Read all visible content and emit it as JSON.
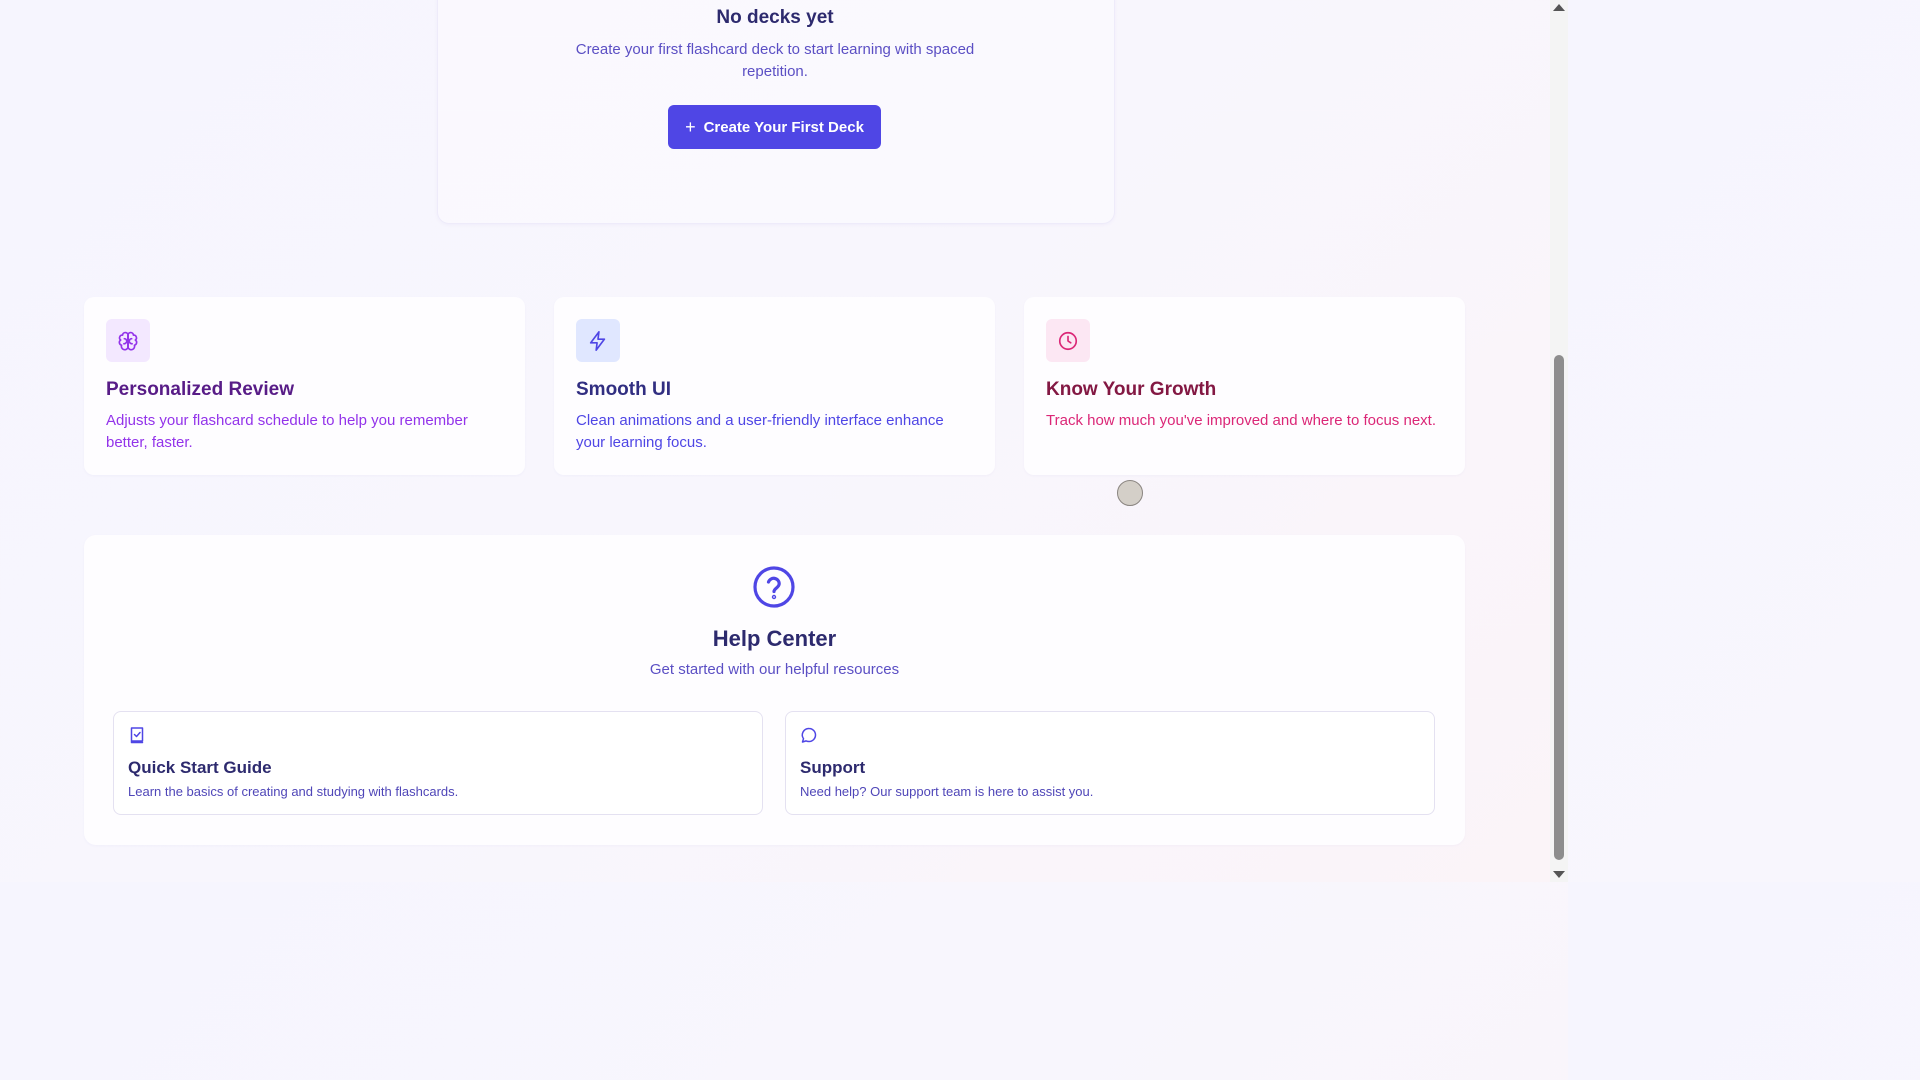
{
  "empty_state": {
    "title": "No decks yet",
    "description": "Create your first flashcard deck to start learning with spaced repetition.",
    "button_label": "Create Your First Deck",
    "button_icon": "plus-icon"
  },
  "features": [
    {
      "icon": "brain-icon",
      "title": "Personalized Review",
      "description": "Adjusts your flashcard schedule to help you remember better, faster.",
      "title_color": "#581c87",
      "desc_color": "#9333ea",
      "icon_bg": "#f3e8ff",
      "icon_color": "#9333ea"
    },
    {
      "icon": "lightning-icon",
      "title": "Smooth UI",
      "description": "Clean animations and a user-friendly interface enhance your learning focus.",
      "title_color": "#312e81",
      "desc_color": "#4f46e5",
      "icon_bg": "#e0e7ff",
      "icon_color": "#4f46e5"
    },
    {
      "icon": "clock-icon",
      "title": "Know Your Growth",
      "description": "Track how much you've improved and where to focus next.",
      "title_color": "#831843",
      "desc_color": "#db2777",
      "icon_bg": "#fce7f3",
      "icon_color": "#db2777"
    }
  ],
  "help_center": {
    "icon": "question-circle-icon",
    "title": "Help Center",
    "subtitle": "Get started with our helpful resources",
    "resources": [
      {
        "icon": "checklist-book-icon",
        "title": "Quick Start Guide",
        "description": "Learn the basics of creating and studying with flashcards."
      },
      {
        "icon": "chat-bubble-icon",
        "title": "Support",
        "description": "Need help? Our support team is here to assist you."
      }
    ]
  },
  "colors": {
    "accent": "#4f46e5",
    "heading": "#2d2a6e"
  }
}
